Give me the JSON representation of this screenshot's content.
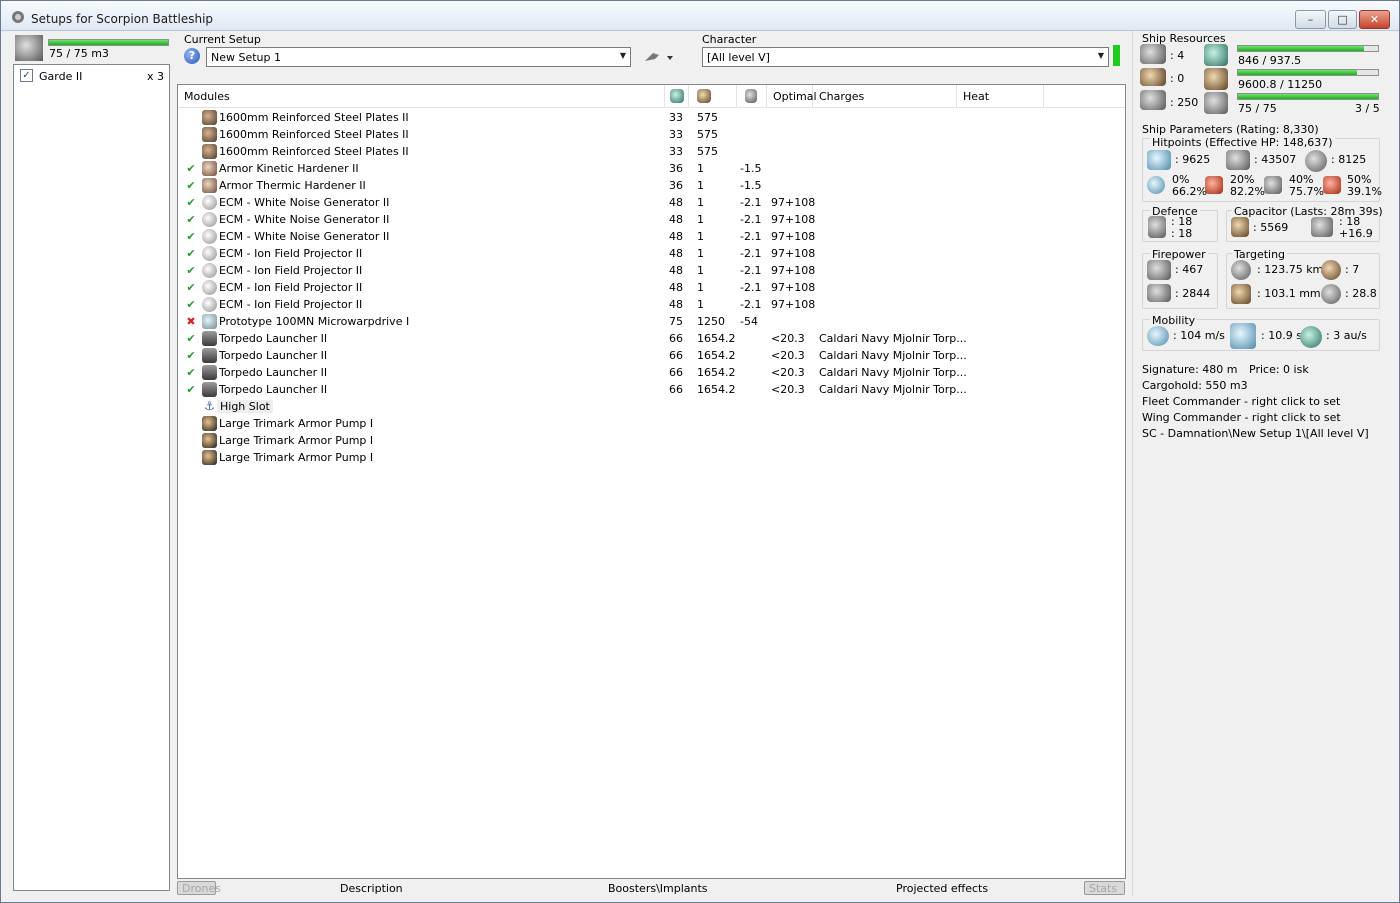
{
  "window": {
    "title": "Setups for Scorpion Battleship",
    "minimize": "–",
    "maximize": "□",
    "close": "✕"
  },
  "drones": {
    "bay": "75 / 75 m3",
    "bay_fill": 1.0,
    "items": [
      {
        "name": "Garde II",
        "qty": "x 3",
        "checked": true
      }
    ]
  },
  "setup": {
    "label": "Current Setup",
    "value": "New Setup 1"
  },
  "character": {
    "label": "Character",
    "value": "[All level V]"
  },
  "modules": {
    "headers": {
      "name": "Modules",
      "optimal": "Optimal",
      "charges": "Charges",
      "heat": "Heat"
    },
    "rows": [
      {
        "status": "",
        "icon": "plate",
        "name": "1600mm Reinforced Steel Plates II",
        "c1": "33",
        "c2": "575",
        "c3": "",
        "c4": "",
        "c5": ""
      },
      {
        "status": "",
        "icon": "plate",
        "name": "1600mm Reinforced Steel Plates II",
        "c1": "33",
        "c2": "575",
        "c3": "",
        "c4": "",
        "c5": ""
      },
      {
        "status": "",
        "icon": "plate",
        "name": "1600mm Reinforced Steel Plates II",
        "c1": "33",
        "c2": "575",
        "c3": "",
        "c4": "",
        "c5": ""
      },
      {
        "status": "ok",
        "icon": "hard",
        "name": "Armor Kinetic Hardener II",
        "c1": "36",
        "c2": "1",
        "c3": "-1.5",
        "c4": "",
        "c5": ""
      },
      {
        "status": "ok",
        "icon": "hard",
        "name": "Armor Thermic Hardener II",
        "c1": "36",
        "c2": "1",
        "c3": "-1.5",
        "c4": "",
        "c5": ""
      },
      {
        "status": "ok",
        "icon": "ecm",
        "name": "ECM - White Noise Generator II",
        "c1": "48",
        "c2": "1",
        "c3": "-2.1",
        "c4": "97+108",
        "c5": ""
      },
      {
        "status": "ok",
        "icon": "ecm",
        "name": "ECM - White Noise Generator II",
        "c1": "48",
        "c2": "1",
        "c3": "-2.1",
        "c4": "97+108",
        "c5": ""
      },
      {
        "status": "ok",
        "icon": "ecm",
        "name": "ECM - White Noise Generator II",
        "c1": "48",
        "c2": "1",
        "c3": "-2.1",
        "c4": "97+108",
        "c5": ""
      },
      {
        "status": "ok",
        "icon": "ecm",
        "name": "ECM - Ion Field Projector II",
        "c1": "48",
        "c2": "1",
        "c3": "-2.1",
        "c4": "97+108",
        "c5": ""
      },
      {
        "status": "ok",
        "icon": "ecm",
        "name": "ECM - Ion Field Projector II",
        "c1": "48",
        "c2": "1",
        "c3": "-2.1",
        "c4": "97+108",
        "c5": ""
      },
      {
        "status": "ok",
        "icon": "ecm",
        "name": "ECM - Ion Field Projector II",
        "c1": "48",
        "c2": "1",
        "c3": "-2.1",
        "c4": "97+108",
        "c5": ""
      },
      {
        "status": "ok",
        "icon": "ecm",
        "name": "ECM - Ion Field Projector II",
        "c1": "48",
        "c2": "1",
        "c3": "-2.1",
        "c4": "97+108",
        "c5": ""
      },
      {
        "status": "bad",
        "icon": "mwd",
        "name": "Prototype 100MN Microwarpdrive I",
        "c1": "75",
        "c2": "1250",
        "c3": "-54",
        "c4": "",
        "c5": ""
      },
      {
        "status": "ok",
        "icon": "torp",
        "name": "Torpedo Launcher II",
        "c1": "66",
        "c2": "1654.2",
        "c3": "",
        "c4": "<20.3",
        "c5": "Caldari Navy Mjolnir Torp..."
      },
      {
        "status": "ok",
        "icon": "torp",
        "name": "Torpedo Launcher II",
        "c1": "66",
        "c2": "1654.2",
        "c3": "",
        "c4": "<20.3",
        "c5": "Caldari Navy Mjolnir Torp..."
      },
      {
        "status": "ok",
        "icon": "torp",
        "name": "Torpedo Launcher II",
        "c1": "66",
        "c2": "1654.2",
        "c3": "",
        "c4": "<20.3",
        "c5": "Caldari Navy Mjolnir Torp..."
      },
      {
        "status": "ok",
        "icon": "torp",
        "name": "Torpedo Launcher II",
        "c1": "66",
        "c2": "1654.2",
        "c3": "",
        "c4": "<20.3",
        "c5": "Caldari Navy Mjolnir Torp..."
      },
      {
        "status": "",
        "icon": "slot",
        "name": "High Slot",
        "c1": "",
        "c2": "",
        "c3": "",
        "c4": "",
        "c5": ""
      },
      {
        "status": "",
        "icon": "rig",
        "name": "Large Trimark Armor Pump I",
        "c1": "",
        "c2": "",
        "c3": "",
        "c4": "",
        "c5": ""
      },
      {
        "status": "",
        "icon": "rig",
        "name": "Large Trimark Armor Pump I",
        "c1": "",
        "c2": "",
        "c3": "",
        "c4": "",
        "c5": ""
      },
      {
        "status": "",
        "icon": "rig",
        "name": "Large Trimark Armor Pump I",
        "c1": "",
        "c2": "",
        "c3": "",
        "c4": "",
        "c5": ""
      }
    ]
  },
  "tabs": {
    "drones": "Drones",
    "description": "Description",
    "boosters": "Boosters\\Implants",
    "projected": "Projected effects",
    "stats": "Stats"
  },
  "resources": {
    "label": "Ship Resources",
    "turrets": ": 4",
    "launchers": ": 0",
    "calibration": ": 250",
    "cpu": "846 / 937.5",
    "cpu_fill": 0.9,
    "powergrid": "9600.8 / 11250",
    "powergrid_fill": 0.85,
    "drone_bw": "75 / 75",
    "drone_bw_fill": 1.0,
    "drones_active": "3 / 5"
  },
  "params": {
    "label": "Ship Parameters (Rating: 8,330)",
    "hitpoints_label": "Hitpoints (Effective HP: 148,637)",
    "shield_hp": ": 9625",
    "armor_hp": ": 43507",
    "structure_hp": ": 8125",
    "res": [
      {
        "top": "0%",
        "bottom": "66.2%"
      },
      {
        "top": "20%",
        "bottom": "82.2%"
      },
      {
        "top": "40%",
        "bottom": "75.7%"
      },
      {
        "top": "50%",
        "bottom": "39.1%"
      }
    ],
    "defence_label": "Defence",
    "defence_a": ": 18",
    "defence_b": ": 18",
    "capacitor_label": "Capacitor (Lasts: 28m 39s)",
    "capacitor": ": 5569",
    "cap_a": ": 18",
    "cap_b": "+16.9",
    "firepower_label": "Firepower",
    "fp_a": ": 467",
    "fp_b": ": 2844",
    "targeting_label": "Targeting",
    "t_range": ": 123.75 km",
    "t_targets": ": 7",
    "t_scan": ": 103.1 mm",
    "t_sensor": ": 28.8",
    "mobility_label": "Mobility",
    "speed": ": 104 m/s",
    "align": ": 10.9 s",
    "warp": ": 3 au/s",
    "signature": "Signature: 480 m",
    "price": "Price: 0 isk",
    "cargohold": "Cargohold: 550 m3",
    "fleet": "Fleet Commander - right click to set",
    "wing": "Wing Commander - right click to set",
    "path": "SC - Damnation\\New Setup 1\\[All level V]"
  }
}
